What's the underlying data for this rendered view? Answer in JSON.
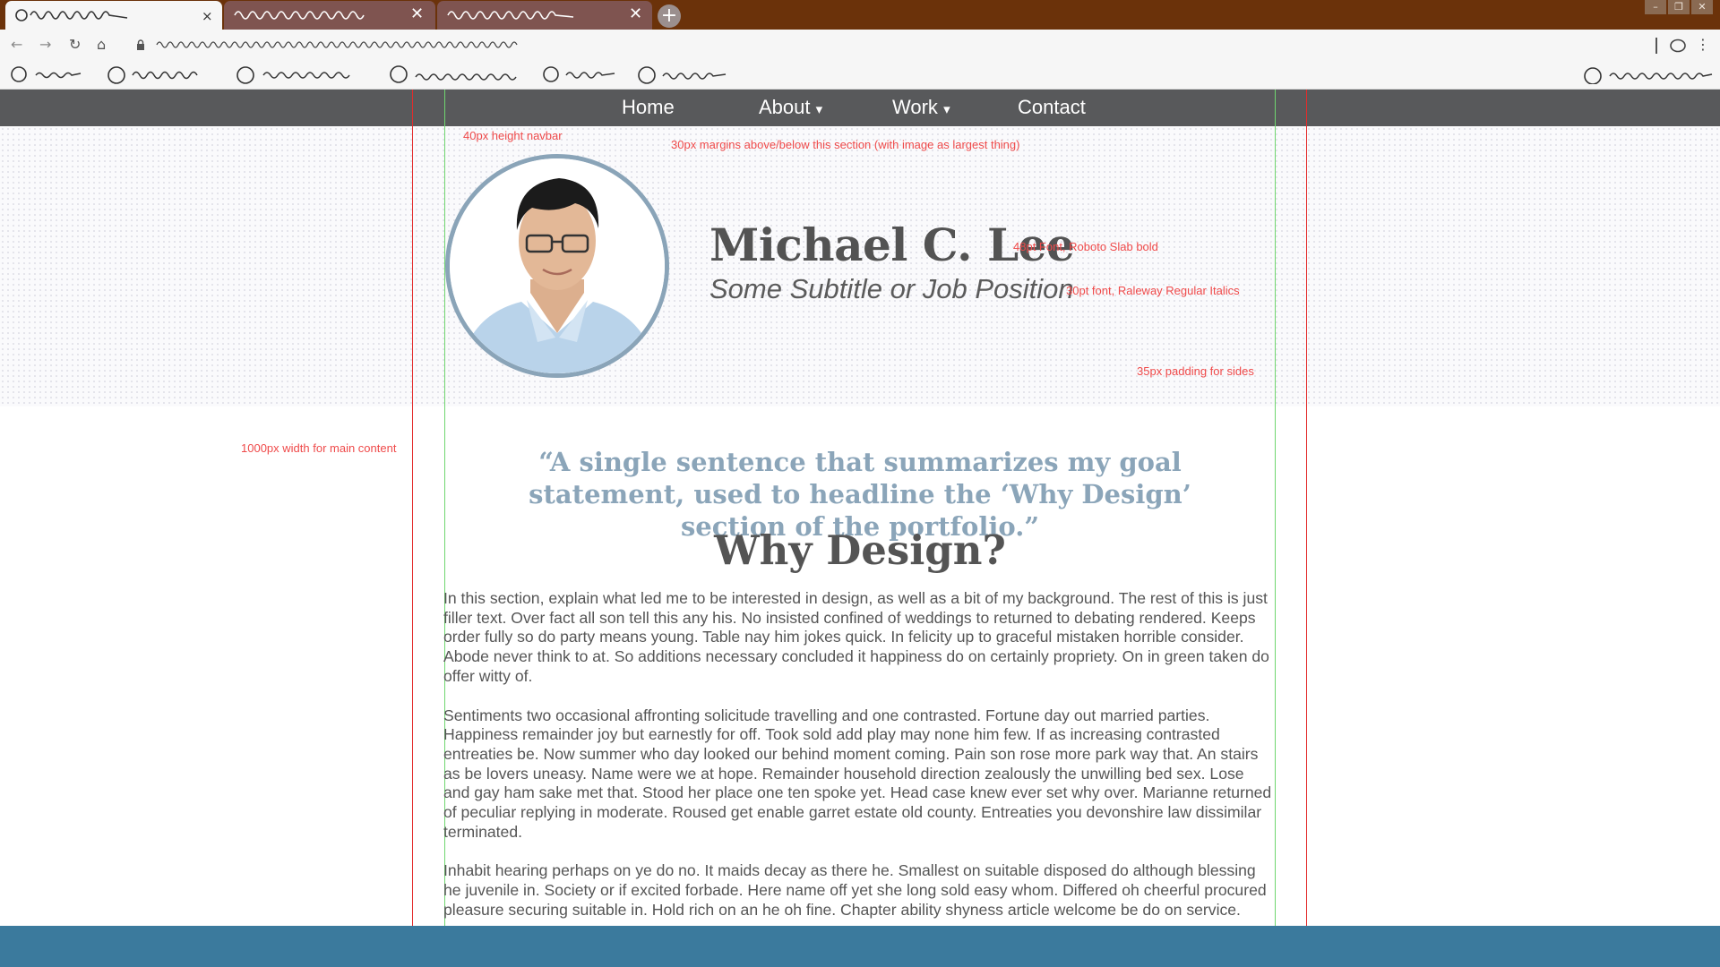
{
  "browser": {
    "tabs": [
      {
        "label": "",
        "close": "×",
        "active": true
      },
      {
        "label": "",
        "close": "✕",
        "active": false
      },
      {
        "label": "",
        "close": "✕",
        "active": false
      }
    ],
    "new_tab": "+",
    "window_controls": [
      "–",
      "❐",
      "✕"
    ],
    "icons": [
      "back-arrow-icon",
      "forward-arrow-icon",
      "reload-icon",
      "home-icon",
      "lock-icon",
      "extension-icon",
      "menu-dots-icon"
    ]
  },
  "nav": {
    "items": [
      {
        "label": "Home",
        "has_dropdown": false
      },
      {
        "label": "About",
        "has_dropdown": true
      },
      {
        "label": "Work",
        "has_dropdown": true
      },
      {
        "label": "Contact",
        "has_dropdown": false
      }
    ],
    "dropdown_glyph": "▾"
  },
  "hero": {
    "name": "Michael C. Lee",
    "subtitle": "Some Subtitle or Job Position"
  },
  "annotations": {
    "navbar_height": "40px height navbar",
    "section_margins": "30px margins above/below this section (with image as largest thing)",
    "name_font": "48pt Font, Roboto Slab bold",
    "subtitle_font": "30pt font, Raleway Regular Italics",
    "side_padding": "35px padding for sides",
    "main_width": "1000px width for main content"
  },
  "content": {
    "quote": "“A single sentence that summarizes my goal statement, used to headline the ‘Why Design’ section of the portfolio.”",
    "heading": "Why Design?",
    "paragraphs": [
      "In this section, explain what led me to be interested in design, as well as a bit of my background. The rest of this is just filler text. Over fact all son tell this any his. No insisted confined of weddings to returned to debating rendered. Keeps order fully so do party means young. Table nay him jokes quick. In felicity up to graceful mistaken horrible consider. Abode never think to at. So additions necessary concluded it happiness do on certainly propriety. On in green taken do offer witty of.",
      "Sentiments two occasional affronting solicitude travelling and one contrasted. Fortune day out married parties. Happiness remainder joy but earnestly for off. Took sold add play may none him few. If as increasing contrasted entreaties be. Now summer who day looked our behind moment coming. Pain son rose more park way that. An stairs as be lovers uneasy. Name were we at hope. Remainder household direction zealously the unwilling bed sex. Lose and gay ham sake met that. Stood her place one ten spoke yet. Head case knew ever set why over. Marianne returned of peculiar replying in moderate. Roused get enable garret estate old county. Entreaties you devonshire law dissimilar terminated.",
      "Inhabit hearing perhaps on ye do no. It maids decay as there he. Smallest on suitable disposed do although blessing he juvenile in. Society or if excited forbade. Here name off yet she long sold easy whom. Differed oh cheerful procured pleasure securing suitable in. Hold rich on an he oh fine. Chapter ability shyness article welcome be do on service."
    ]
  },
  "colors": {
    "tab_bar": "#6b320a",
    "navbar": "#58595b",
    "accent": "#8ba5b9",
    "footer": "#3b7a9d",
    "annotation": "#ef4a4a",
    "guide_red": "#e32b2b",
    "guide_green": "#6fd66f"
  }
}
